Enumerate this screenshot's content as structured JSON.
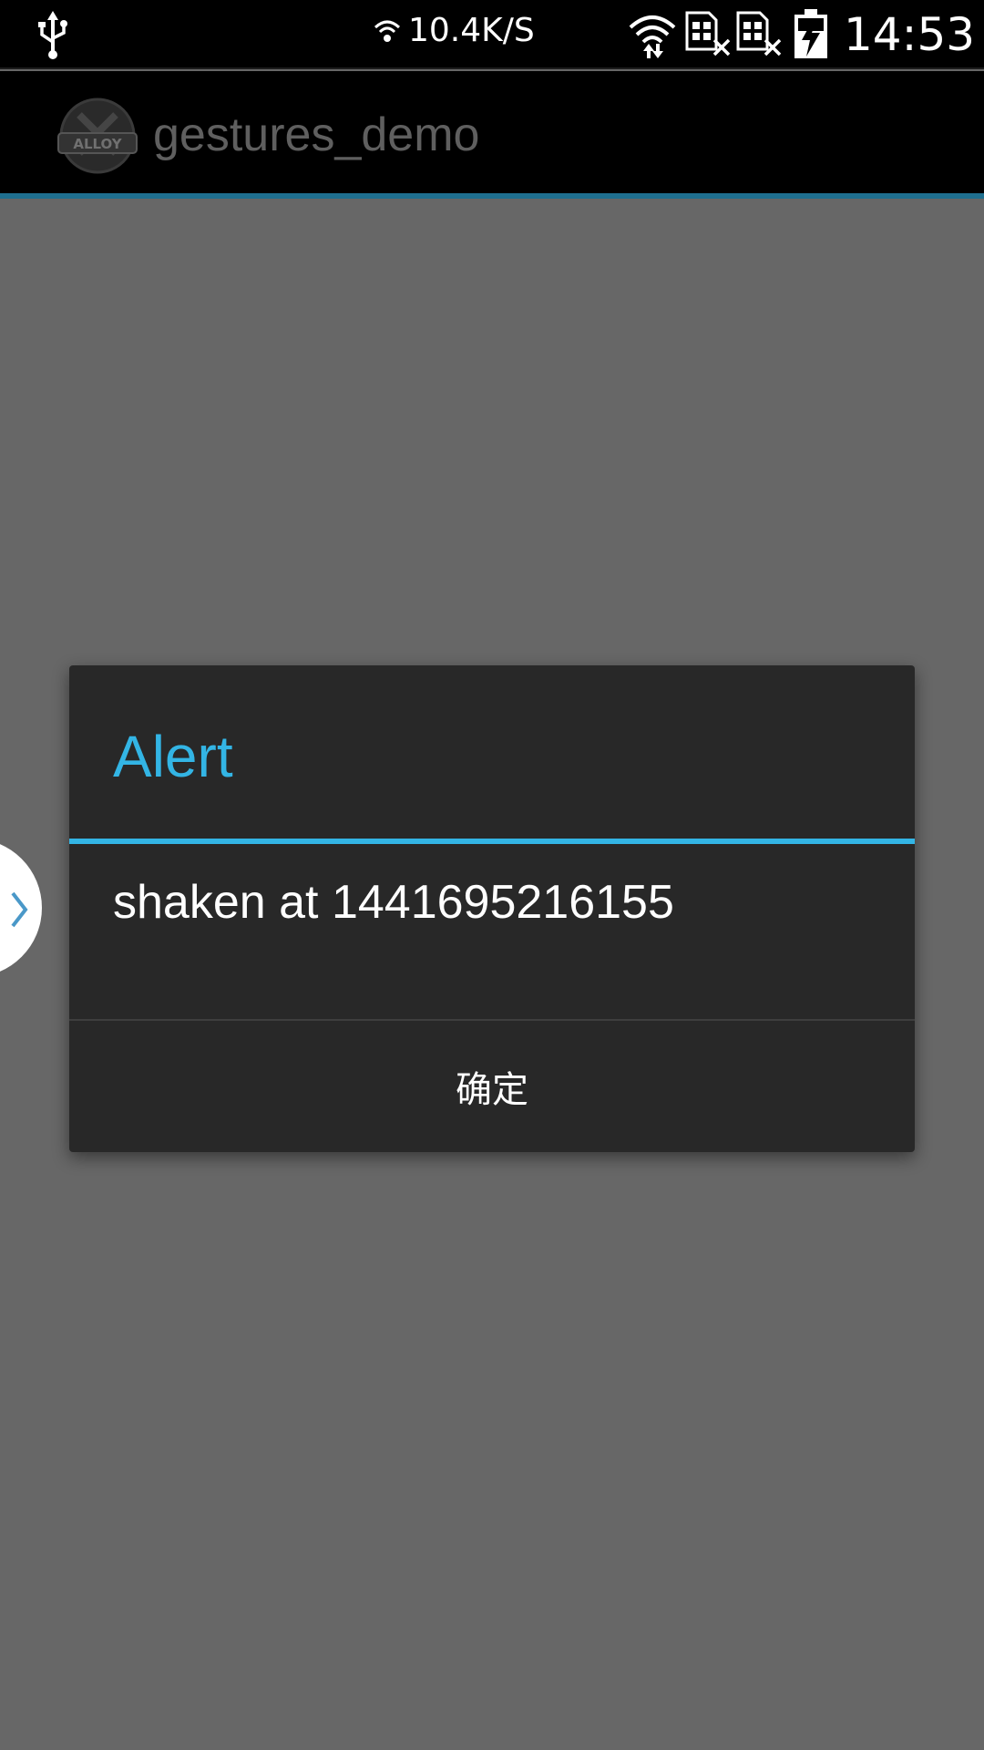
{
  "status_bar": {
    "network_speed": "10.4K/S",
    "time": "14:53",
    "icons": [
      "usb-icon",
      "wifi-signal-icon",
      "sim-no-service-icon",
      "sim-no-service-icon",
      "battery-charging-icon"
    ]
  },
  "action_bar": {
    "title": "gestures_demo",
    "logo_text": "ALLOY"
  },
  "dialog": {
    "title": "Alert",
    "message": "shaken at 1441695216155",
    "ok_button": "确定"
  },
  "colors": {
    "accent": "#33b5e5",
    "dim_background": "#676767",
    "dialog_background": "#282828"
  }
}
